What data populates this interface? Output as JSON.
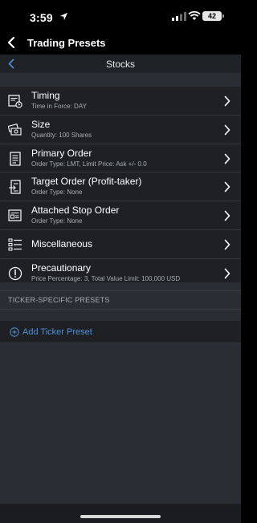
{
  "status_bar": {
    "time": "3:59",
    "battery": "42"
  },
  "nav": {
    "title": "Trading Presets"
  },
  "sub_header": {
    "title": "Stocks"
  },
  "presets": [
    {
      "title": "Timing",
      "subtitle": "Time in Force: DAY",
      "icon": "clock-document-icon"
    },
    {
      "title": "Size",
      "subtitle": "Quantity: 100 Shares",
      "icon": "money-stack-icon"
    },
    {
      "title": "Primary Order",
      "subtitle": "Order Type: LMT, Limit Price: Ask +/- 0.0",
      "icon": "order-list-icon"
    },
    {
      "title": "Target Order (Profit-taker)",
      "subtitle": "Order Type: None",
      "icon": "target-order-icon"
    },
    {
      "title": "Attached Stop Order",
      "subtitle": "Order Type: None",
      "icon": "stop-order-icon"
    },
    {
      "title": "Miscellaneous",
      "subtitle": "",
      "icon": "misc-list-icon"
    },
    {
      "title": "Precautionary",
      "subtitle": "Price Percentage: 3, Total Value Limit: 100,000 USD",
      "icon": "exclamation-circle-icon"
    }
  ],
  "ticker_section": {
    "header": "TICKER-SPECIFIC PRESETS",
    "add_label": "Add Ticker Preset"
  },
  "colors": {
    "accent": "#4f90d9",
    "background": "#2a2d33",
    "row_bg": "#1e2024"
  }
}
